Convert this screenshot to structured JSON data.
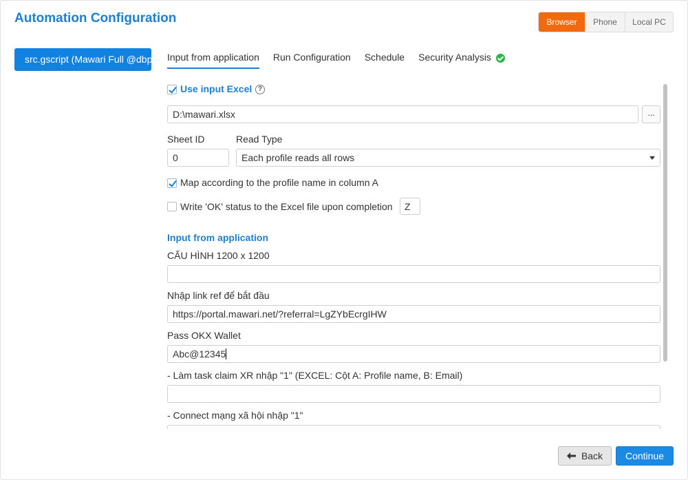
{
  "header": {
    "title": "Automation Configuration",
    "platforms": [
      {
        "label": "Browser",
        "active": true
      },
      {
        "label": "Phone",
        "active": false
      },
      {
        "label": "Local PC",
        "active": false
      }
    ],
    "accent_color": "#f26a0d"
  },
  "sidebar": {
    "script_label": "src.gscript   (Mawari Full @dbp",
    "color": "#1182e0"
  },
  "tabs": [
    {
      "label": "Input from application",
      "active": true
    },
    {
      "label": "Run Configuration",
      "active": false
    },
    {
      "label": "Schedule",
      "active": false
    },
    {
      "label": "Security Analysis",
      "active": false,
      "status_icon": "check-circle-icon"
    }
  ],
  "excel": {
    "use_input_label": "Use input Excel",
    "use_input_checked": true,
    "file_path": "D:\\mawari.xlsx",
    "browse_label": "...",
    "sheet_id_label": "Sheet ID",
    "sheet_id_value": "0",
    "read_type_label": "Read Type",
    "read_type_value": "Each profile reads all rows",
    "map_label": "Map according to the profile name in column A",
    "map_checked": true,
    "write_ok_label": "Write 'OK' status to the Excel file upon completion",
    "write_ok_checked": false,
    "write_ok_column": "Z"
  },
  "app_inputs": {
    "section_title": "Input from application",
    "fields": [
      {
        "label": "CẤU HÌNH 1200 x 1200",
        "value": ""
      },
      {
        "label": "Nhập link ref để bắt đầu",
        "value": "https://portal.mawari.net/?referral=LgZYbEcrgIHW"
      },
      {
        "label": "Pass OKX Wallet",
        "value": "Abc@12345"
      },
      {
        "label": "- Làm task claim XR nhập \"1\" (EXCEL: Cột A: Profile name, B: Email)",
        "value": ""
      },
      {
        "label": "- Connect mạng xã hội nhập \"1\"",
        "value": ""
      }
    ]
  },
  "footer": {
    "back_label": "Back",
    "continue_label": "Continue"
  }
}
